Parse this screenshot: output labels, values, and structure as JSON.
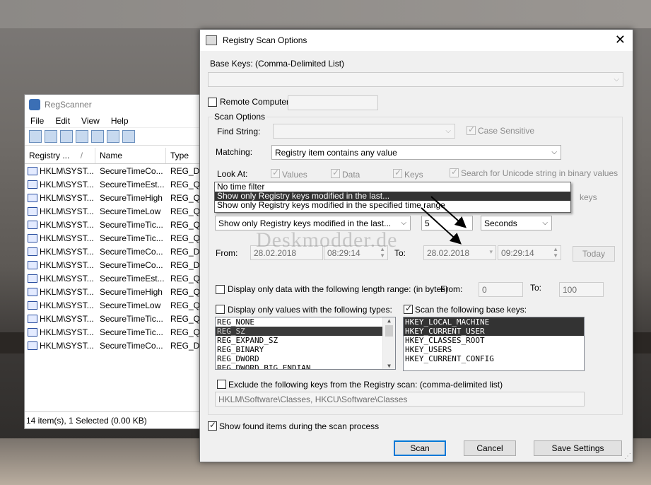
{
  "regscanner": {
    "title": "RegScanner",
    "menu": [
      "File",
      "Edit",
      "View",
      "Help"
    ],
    "columns": [
      "Registry ...",
      "Name",
      "Type"
    ],
    "sort_indicator": "/",
    "rows": [
      {
        "key": "HKLM\\SYST...",
        "name": "SecureTimeCo...",
        "type": "REG_DV"
      },
      {
        "key": "HKLM\\SYST...",
        "name": "SecureTimeEst...",
        "type": "REG_QV"
      },
      {
        "key": "HKLM\\SYST...",
        "name": "SecureTimeHigh",
        "type": "REG_QV"
      },
      {
        "key": "HKLM\\SYST...",
        "name": "SecureTimeLow",
        "type": "REG_QV"
      },
      {
        "key": "HKLM\\SYST...",
        "name": "SecureTimeTic...",
        "type": "REG_QV"
      },
      {
        "key": "HKLM\\SYST...",
        "name": "SecureTimeTic...",
        "type": "REG_QV"
      },
      {
        "key": "HKLM\\SYST...",
        "name": "SecureTimeCo...",
        "type": "REG_DV"
      },
      {
        "key": "HKLM\\SYST...",
        "name": "SecureTimeCo...",
        "type": "REG_DV"
      },
      {
        "key": "HKLM\\SYST...",
        "name": "SecureTimeEst...",
        "type": "REG_QV"
      },
      {
        "key": "HKLM\\SYST...",
        "name": "SecureTimeHigh",
        "type": "REG_QV"
      },
      {
        "key": "HKLM\\SYST...",
        "name": "SecureTimeLow",
        "type": "REG_QV"
      },
      {
        "key": "HKLM\\SYST...",
        "name": "SecureTimeTic...",
        "type": "REG_QV"
      },
      {
        "key": "HKLM\\SYST...",
        "name": "SecureTimeTic...",
        "type": "REG_QV"
      },
      {
        "key": "HKLM\\SYST...",
        "name": "SecureTimeCo...",
        "type": "REG_DV"
      }
    ],
    "status": "14 item(s), 1 Selected  (0.00 KB)"
  },
  "dialog": {
    "title": "Registry Scan Options",
    "close_glyph": "✕",
    "base_keys_label": "Base Keys:  (Comma-Delimited List)",
    "base_keys_value": "",
    "remote_computer_label": "Remote Computer:",
    "remote_computer_value": "",
    "scan_options_label": "Scan Options",
    "find_string_label": "Find String:",
    "find_string_value": "",
    "case_sensitive_label": "Case Sensitive",
    "matching_label": "Matching:",
    "matching_value": "Registry item contains any value",
    "look_at_label": "Look At:",
    "values_label": "Values",
    "data_label": "Data",
    "keys_label": "Keys",
    "unicode_label": "Search for Unicode string in binary values",
    "keys_partial_label": "keys",
    "time_filter_options": [
      "No time filter",
      "Show only Registry keys modified in the last...",
      "Show only Registry keys modified in the specified time range"
    ],
    "time_filter_value": "Show only Registry keys modified in the last...",
    "time_amount": "5",
    "time_unit": "Seconds",
    "from_label": "From:",
    "from_date": "28.02.2018",
    "from_time": "08:29:14",
    "to_label": "To:",
    "to_date": "28.02.2018",
    "to_time": "09:29:14",
    "today_label": "Today",
    "watermark": "Deskmodder.de",
    "length_range_label": "Display only data with the following length range: (in bytes)",
    "length_from_label": "From:",
    "length_from": "0",
    "length_to_label": "To:",
    "length_to": "100",
    "types_label": "Display only values with the following types:",
    "types": [
      "REG_NONE",
      "REG_SZ",
      "REG_EXPAND_SZ",
      "REG_BINARY",
      "REG_DWORD",
      "REG_DWORD_BIG_ENDIAN"
    ],
    "base_keys_scan_label": "Scan the following base keys:",
    "scan_keys": [
      "HKEY_LOCAL_MACHINE",
      "HKEY_CURRENT_USER",
      "HKEY_CLASSES_ROOT",
      "HKEY_USERS",
      "HKEY_CURRENT_CONFIG"
    ],
    "exclude_label": "Exclude the following keys from the Registry scan: (comma-delimited list)",
    "exclude_value": "HKLM\\Software\\Classes, HKCU\\Software\\Classes",
    "show_found_label": "Show found items during the scan process",
    "scan_button": "Scan",
    "cancel_button": "Cancel",
    "save_button": "Save Settings"
  }
}
